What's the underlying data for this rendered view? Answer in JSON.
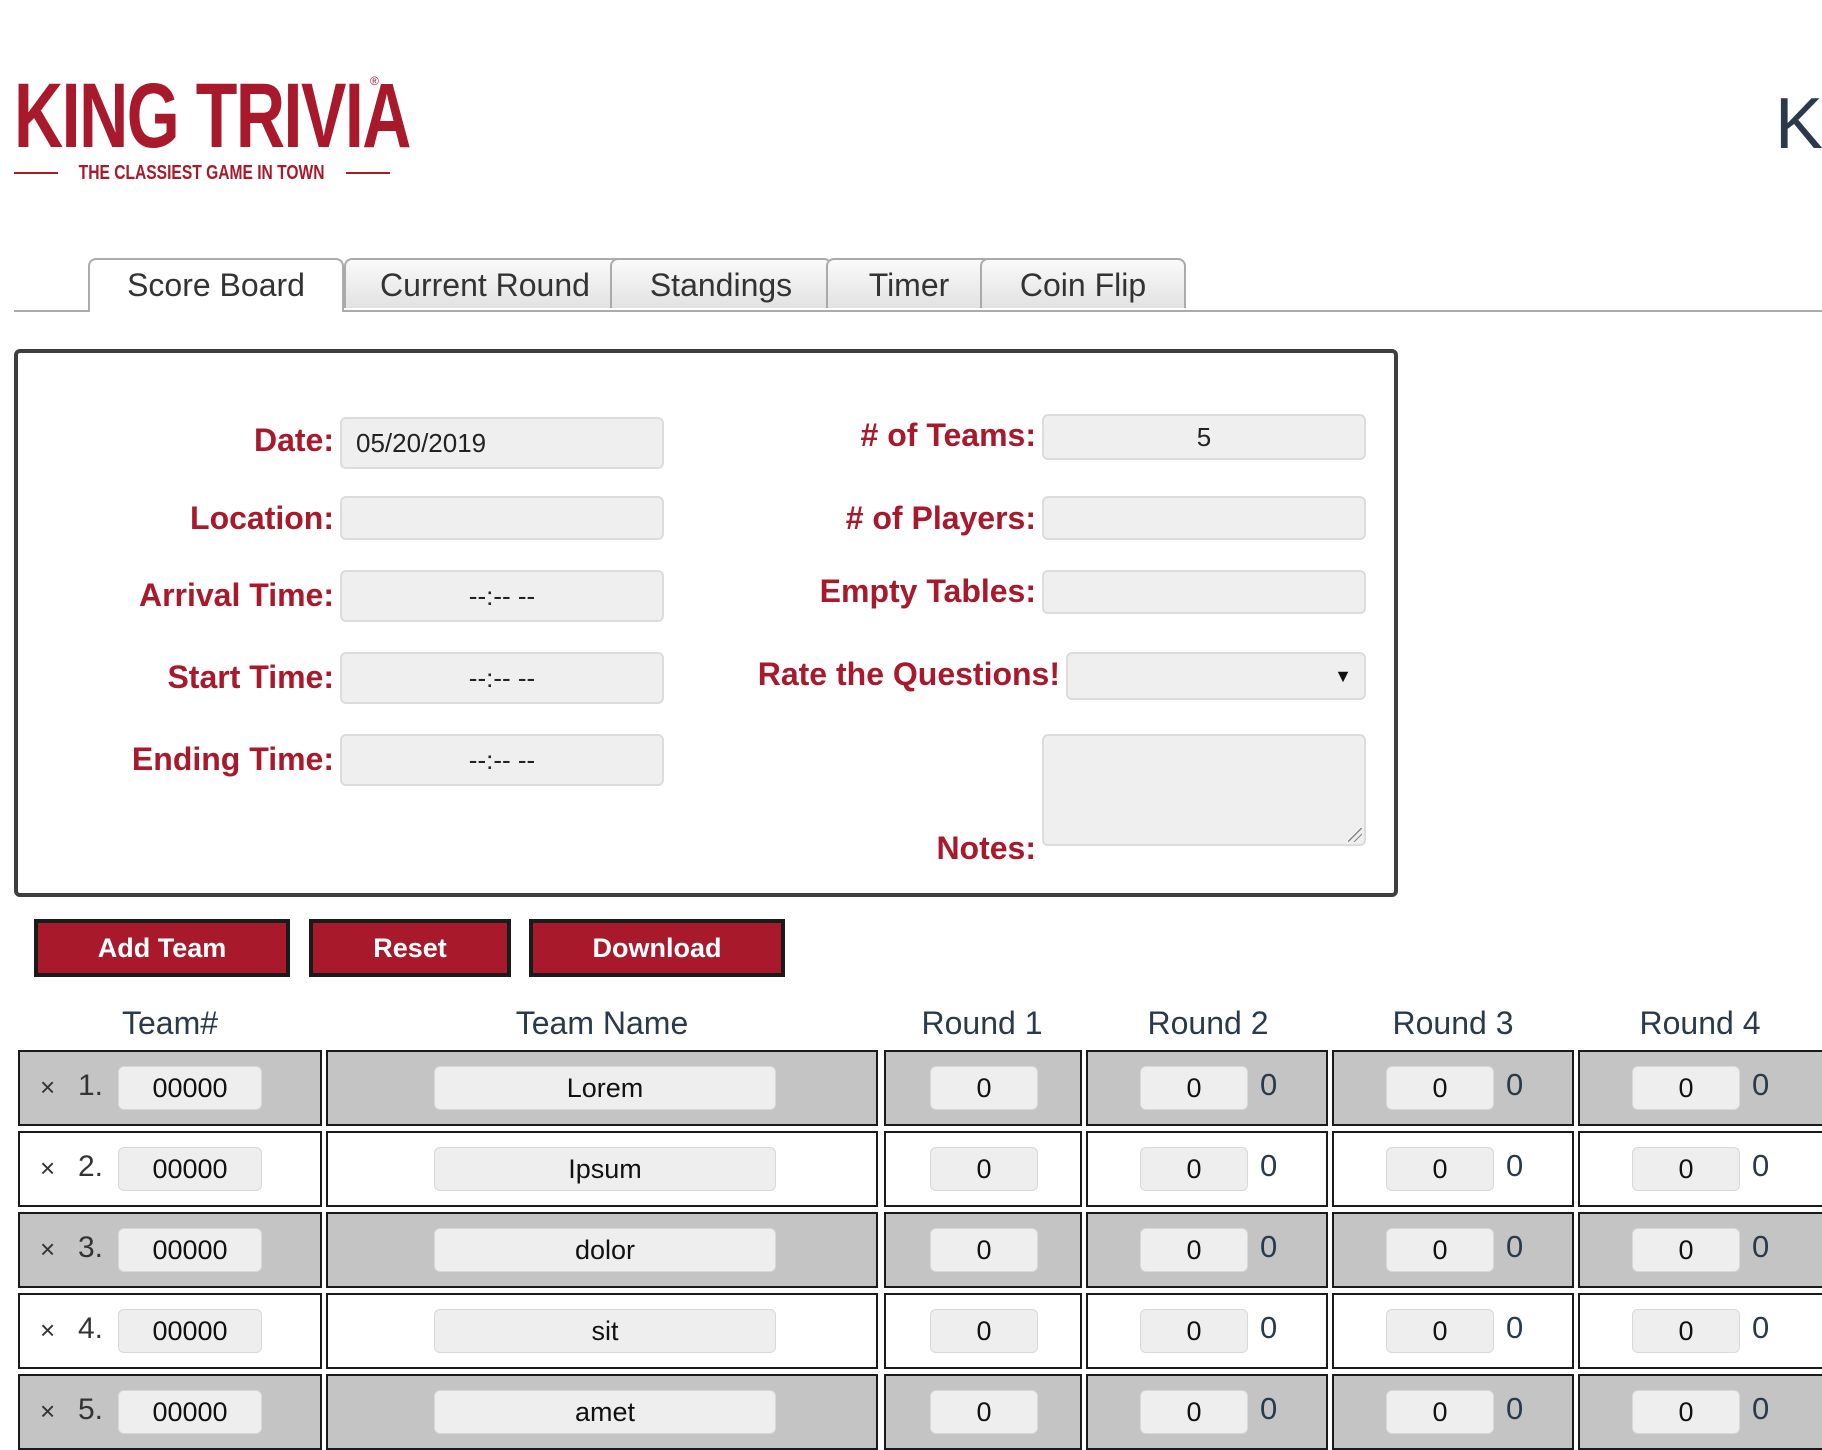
{
  "header": {
    "logo_text": "KING TRIVIA",
    "logo_tagline": "THE CLASSIEST GAME IN TOWN",
    "logo_registered": "®",
    "right_title_partial": "Ki"
  },
  "tabs": [
    "Score Board",
    "Current Round",
    "Standings",
    "Timer",
    "Coin Flip"
  ],
  "active_tab": "Score Board",
  "form": {
    "date_label": "Date:",
    "date_value": "05/20/2019",
    "location_label": "Location:",
    "location_value": "",
    "arrival_label": "Arrival Time:",
    "arrival_value": "--:-- --",
    "start_label": "Start Time:",
    "start_value": "--:-- --",
    "ending_label": "Ending Time:",
    "ending_value": "--:-- --",
    "teams_label": "# of Teams:",
    "teams_value": "5",
    "players_label": "# of Players:",
    "players_value": "",
    "empty_tables_label": "Empty Tables:",
    "empty_tables_value": "",
    "rate_label": "Rate the Questions!",
    "rate_value": "",
    "notes_label": "Notes:",
    "notes_value": ""
  },
  "buttons": {
    "add_team": "Add Team",
    "reset": "Reset",
    "download": "Download"
  },
  "table": {
    "headers": [
      "Team#",
      "Team Name",
      "Round 1",
      "Round 2",
      "Round 3",
      "Round 4"
    ],
    "remove_symbol": "×",
    "rows": [
      {
        "num": "1.",
        "team_id": "00000",
        "name": "Lorem",
        "r1": "0",
        "r2": "0",
        "r2_total": "0",
        "r3": "0",
        "r3_total": "0",
        "r4": "0",
        "r4_total": "0"
      },
      {
        "num": "2.",
        "team_id": "00000",
        "name": "Ipsum",
        "r1": "0",
        "r2": "0",
        "r2_total": "0",
        "r3": "0",
        "r3_total": "0",
        "r4": "0",
        "r4_total": "0"
      },
      {
        "num": "3.",
        "team_id": "00000",
        "name": "dolor",
        "r1": "0",
        "r2": "0",
        "r2_total": "0",
        "r3": "0",
        "r3_total": "0",
        "r4": "0",
        "r4_total": "0"
      },
      {
        "num": "4.",
        "team_id": "00000",
        "name": "sit",
        "r1": "0",
        "r2": "0",
        "r2_total": "0",
        "r3": "0",
        "r3_total": "0",
        "r4": "0",
        "r4_total": "0"
      },
      {
        "num": "5.",
        "team_id": "00000",
        "name": "amet",
        "r1": "0",
        "r2": "0",
        "r2_total": "0",
        "r3": "0",
        "r3_total": "0",
        "r4": "0",
        "r4_total": "0"
      }
    ]
  },
  "colors": {
    "brand_red": "#a8192b",
    "row_gray": "#c4c4c4",
    "heading_navy": "#2b3a4a"
  }
}
